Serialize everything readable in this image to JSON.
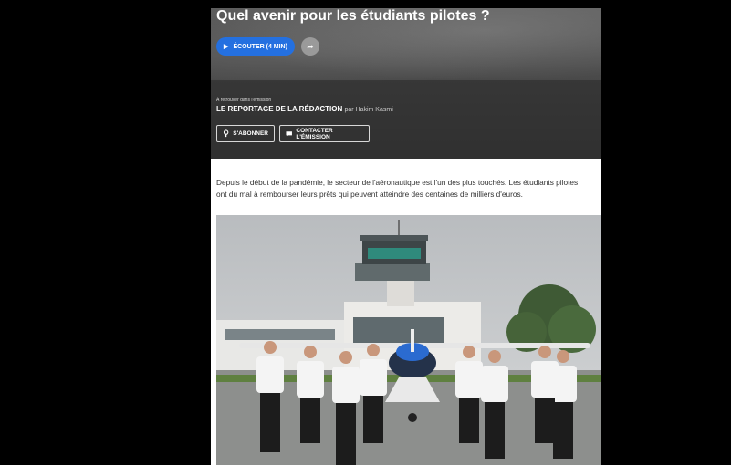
{
  "article": {
    "title": "Quel avenir pour les étudiants pilotes ?",
    "listen_label": "ÉCOUTER (4 MIN)",
    "listen_icon": "play-icon",
    "share_icon": "share-arrow-icon",
    "retrouver_label": "À retrouver dans l'émission",
    "show_name": "LE REPORTAGE DE LA RÉDACTION",
    "author": "par Hakim Kasmi",
    "subscribe_label": "S'ABONNER",
    "subscribe_icon": "podcast-icon",
    "contact_label": "CONTACTER L'ÉMISSION",
    "contact_icon": "message-icon",
    "intro": "Depuis le début de la pandémie, le secteur de l'aéronautique est l'un des plus touchés. Les étudiants pilotes ont du mal à rembourser leurs prêts qui peuvent atteindre des centaines de milliers d'euros.",
    "photo": "eight student pilots in front of a small propeller plane and airport control tower"
  },
  "colors": {
    "background": "#000000",
    "accent_blue": "#2470e0",
    "hero_gray": "#4a4a4a"
  }
}
